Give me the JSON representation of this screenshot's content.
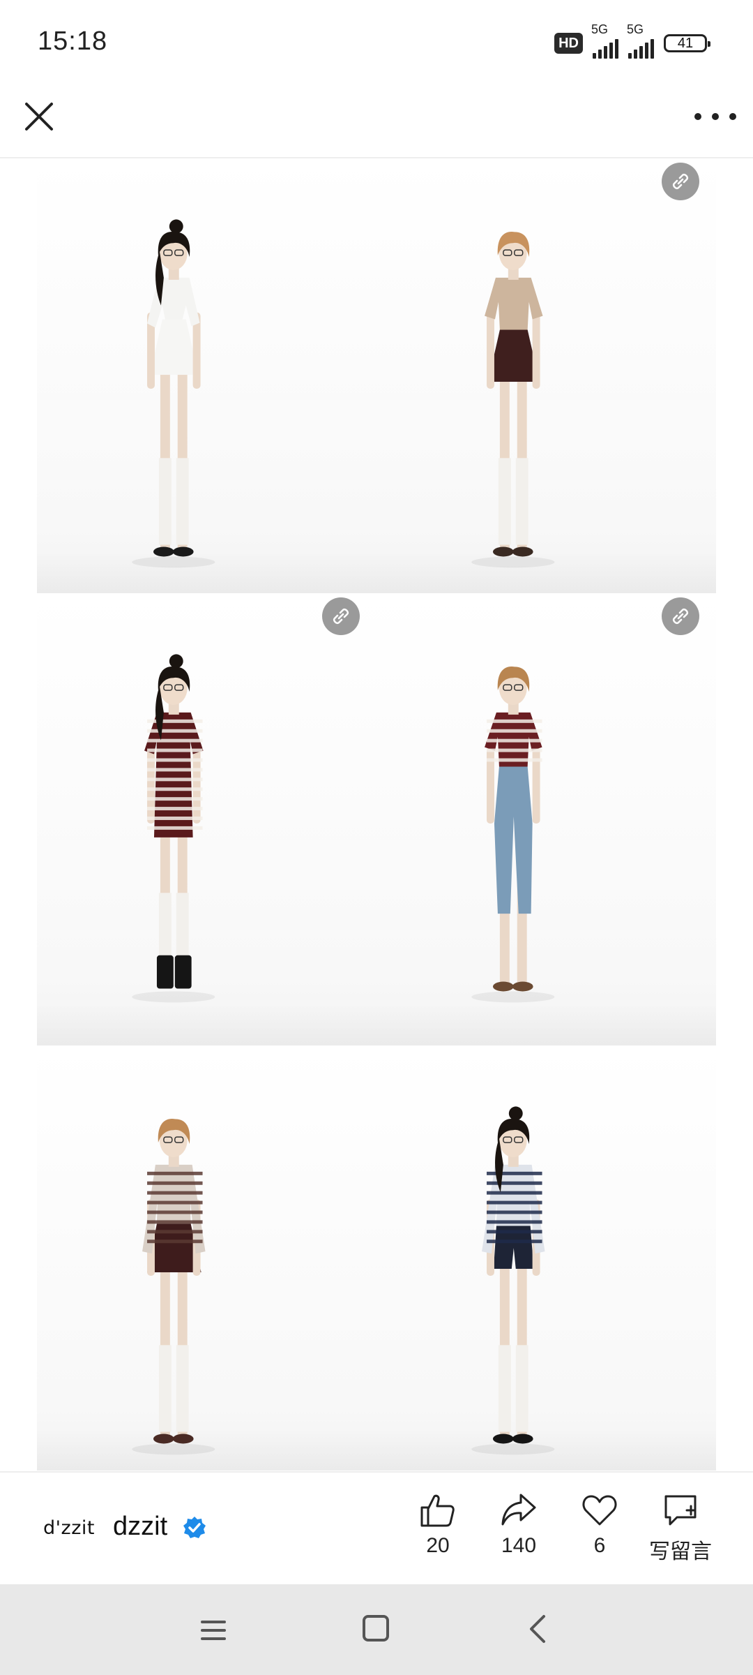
{
  "status_bar": {
    "time": "15:18",
    "hd_badge": "HD",
    "network_1": "5G",
    "network_2": "5G",
    "battery": "41"
  },
  "top_bar": {
    "close_icon": "close-icon",
    "more_icon": "more-icon"
  },
  "gallery": {
    "items": [
      {
        "outfit": "white sailor-collar knit top with white pleated skirt",
        "colors": {
          "top": "#f4f4f2",
          "bottom": "#f6f6f4",
          "hair": "#1a1410",
          "shoes": "#1a1a1a"
        },
        "has_link": false
      },
      {
        "outfit": "beige fair-isle cardigan with burgundy pleated skirt",
        "colors": {
          "top": "#cdb59d",
          "bottom": "#3f1f1e",
          "hair": "#c8925e",
          "shoes": "#3a2a22"
        },
        "has_link": true
      },
      {
        "outfit": "burgundy striped polo dress with black boots",
        "colors": {
          "top": "#5a1a1c",
          "bottom": "#5a1a1c",
          "hair": "#1a1410",
          "shoes": "#151515"
        },
        "has_link": true
      },
      {
        "outfit": "burgundy striped tee with light-wash wide jeans",
        "colors": {
          "top": "#6a1e22",
          "bottom": "#7b9cb8",
          "hair": "#b98550",
          "shoes": "#6b4a32"
        },
        "has_link": true
      },
      {
        "outfit": "brown striped long-sleeve with burgundy pleated skirt",
        "colors": {
          "top": "#d9cfc6",
          "bottom": "#3e1c1c",
          "hair": "#c08a55",
          "shoes": "#4a2a24"
        },
        "has_link": false
      },
      {
        "outfit": "navy striped long-sleeve with navy shorts",
        "colors": {
          "top": "#dfe3ea",
          "bottom": "#1e2436",
          "hair": "#1a1410",
          "shoes": "#151515"
        },
        "has_link": false
      }
    ]
  },
  "bottom_bar": {
    "brand_logo": "d'zzit",
    "brand_name": "dzzit",
    "verified_icon": "verified-badge-icon",
    "actions": [
      {
        "icon": "thumbs-up-icon",
        "count": "20"
      },
      {
        "icon": "share-icon",
        "count": "140"
      },
      {
        "icon": "heart-icon",
        "count": "6"
      },
      {
        "icon": "comment-plus-icon",
        "count": "写留言"
      }
    ]
  },
  "nav_bar": {
    "menu_icon": "menu-icon",
    "home_icon": "home-icon",
    "back_icon": "back-icon"
  },
  "accent": "#1e8be9"
}
